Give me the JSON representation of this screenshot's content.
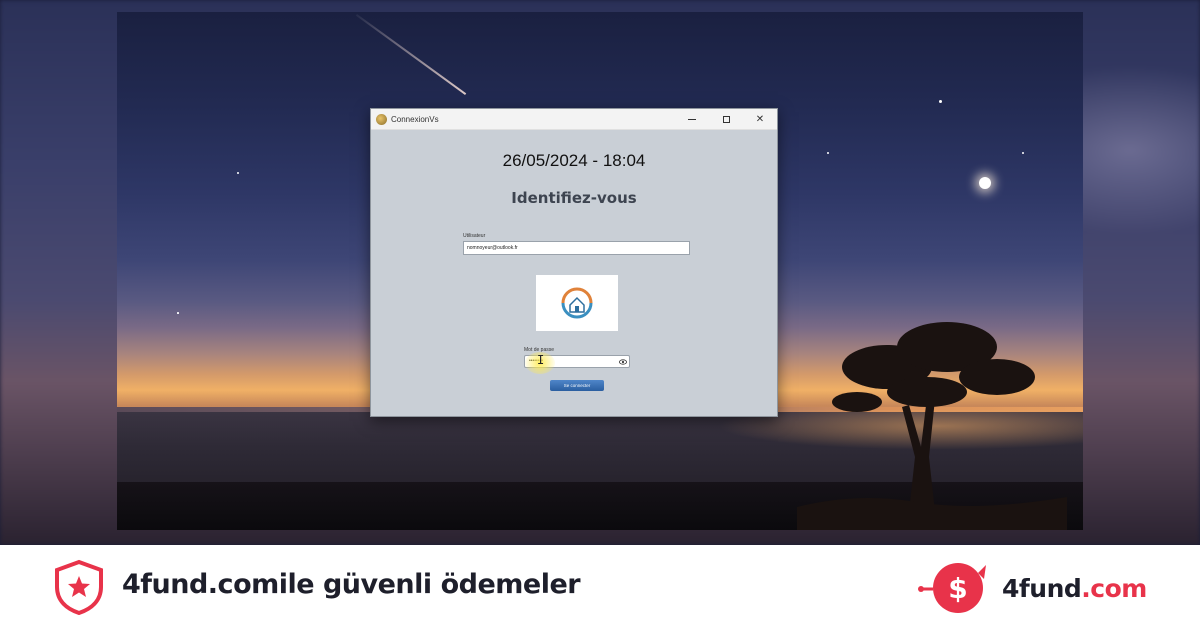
{
  "window": {
    "title": "ConnexionVs",
    "controls": {
      "minimize": "—",
      "maximize": "□",
      "close": "✕"
    }
  },
  "login": {
    "datetime": "26/05/2024 - 18:04",
    "heading": "Identifiez-vous",
    "user_label": "Utilisateur",
    "user_value": "nomnoyeur@outlook.fr",
    "password_label": "Mot de passe",
    "password_value": "••••••••",
    "button_label": "Se connecter"
  },
  "footer": {
    "tagline": "4fund.comile güvenli ödemeler",
    "brand_name": "4fund",
    "brand_tld": ".com"
  },
  "colors": {
    "brand_red": "#e8334a",
    "text_dark": "#1e1f2b",
    "window_bg": "#c9cfd6"
  },
  "icons": [
    "app-icon",
    "minimize-icon",
    "maximize-icon",
    "close-icon",
    "eye-icon",
    "shield-star-icon",
    "piggy-bank-icon"
  ]
}
